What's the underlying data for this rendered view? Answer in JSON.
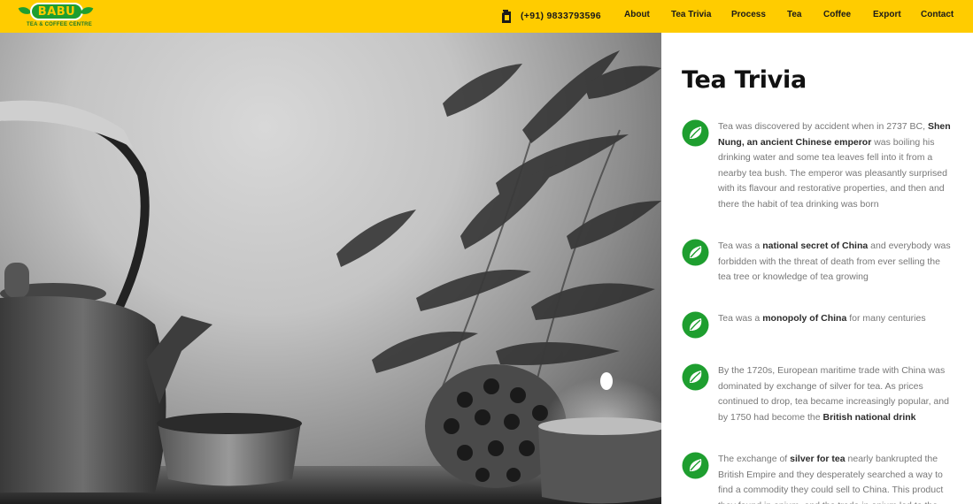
{
  "header": {
    "logo_text": "BABU",
    "logo_subtext": "TEA & COFFEE CENTRE",
    "phone": "(+91) 9833793596",
    "nav": [
      {
        "label": "About"
      },
      {
        "label": "Tea Trivia"
      },
      {
        "label": "Process"
      },
      {
        "label": "Tea"
      },
      {
        "label": "Coffee"
      },
      {
        "label": "Export"
      },
      {
        "label": "Contact"
      }
    ]
  },
  "colors": {
    "header_bg": "#FFCC00",
    "brand_green": "#1E9E2F",
    "text_muted": "#777777"
  },
  "hero": {
    "icon": "teapot-photo"
  },
  "trivia": {
    "title": "Tea Trivia",
    "icon": "tea-leaf-icon",
    "facts": [
      [
        {
          "t": "Tea was discovered by accident when in 2737 BC, "
        },
        {
          "t": "Shen Nung, an ancient Chinese emperor",
          "b": true
        },
        {
          "t": " was boiling his drinking water and some tea leaves fell into it from a nearby tea bush. The emperor was pleasantly surprised with its flavour and restorative properties, and then and there the habit of tea drinking was born"
        }
      ],
      [
        {
          "t": "Tea was a "
        },
        {
          "t": "national secret of China",
          "b": true
        },
        {
          "t": " and everybody was forbidden with the threat of death from ever selling the tea tree or knowledge of tea growing"
        }
      ],
      [
        {
          "t": "Tea was a "
        },
        {
          "t": "monopoly of China",
          "b": true
        },
        {
          "t": " for many centuries"
        }
      ],
      [
        {
          "t": "By the 1720s, European maritime trade with China was dominated by exchange of silver for tea. As prices continued to drop, tea became increasingly popular, and by 1750 had become the "
        },
        {
          "t": "British national drink",
          "b": true
        }
      ],
      [
        {
          "t": "The exchange of "
        },
        {
          "t": "silver for tea",
          "b": true
        },
        {
          "t": " nearly bankrupted the British Empire and they desperately searched a way to find a commodity they could sell to China. This product they found in opium, and the trade in opium led to the"
        }
      ]
    ]
  }
}
